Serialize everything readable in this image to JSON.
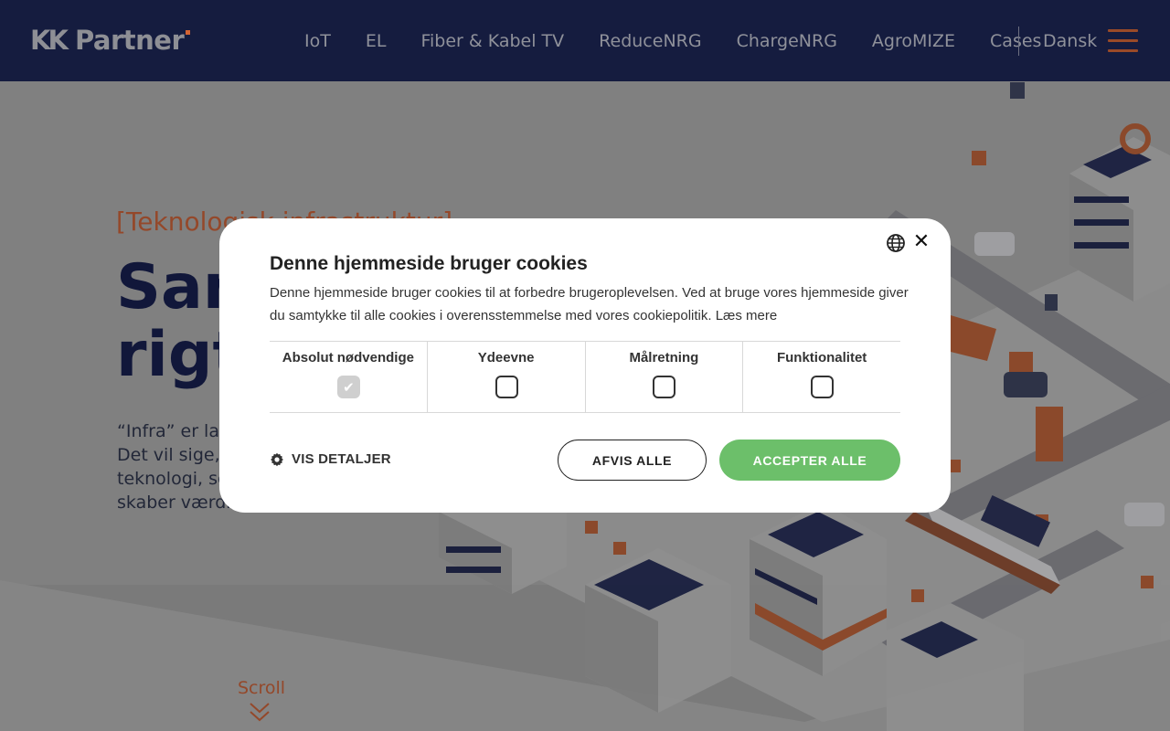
{
  "header": {
    "logo": {
      "brand": "KK",
      "name": "Partner"
    },
    "nav": [
      "IoT",
      "EL",
      "Fiber & Kabel TV",
      "ReduceNRG",
      "ChargeNRG",
      "AgroMIZE",
      "Cases"
    ],
    "language": "Dansk",
    "menu_icon": "hamburger-menu-icon"
  },
  "hero": {
    "kicker": "[Teknologisk infrastruktur]",
    "headline_lines": [
      "Sam",
      "rigt"
    ],
    "intro_lines": [
      "“Infra” er lati",
      "Det vil sige, a",
      "teknologi, so",
      "skaber værdi"
    ],
    "scroll_label": "Scroll",
    "scroll_icon": "double-chevron-down-icon"
  },
  "cookie_dialog": {
    "title": "Denne hjemmeside bruger cookies",
    "body": "Denne hjemmeside bruger cookies til at forbedre brugeroplevelsen. Ved at bruge vores hjemmeside giver du samtykke til alle cookies i overensstemmelse med vores cookiepolitik.",
    "read_more": "Læs mere",
    "categories": [
      {
        "label": "Absolut nødvendige",
        "checked": true,
        "disabled": true
      },
      {
        "label": "Ydeevne",
        "checked": false
      },
      {
        "label": "Målretning",
        "checked": false
      },
      {
        "label": "Funktionalitet",
        "checked": false
      }
    ],
    "details_label": "VIS DETALJER",
    "details_icon": "gear-icon",
    "reject_label": "AFVIS ALLE",
    "accept_label": "ACCEPTER ALLE",
    "language_icon": "globe-icon",
    "close_icon": "close-icon"
  },
  "colors": {
    "header_bg": "#151c3f",
    "accent_orange": "#d36332",
    "accept_green": "#6cbf6a",
    "navy": "#11173a"
  }
}
